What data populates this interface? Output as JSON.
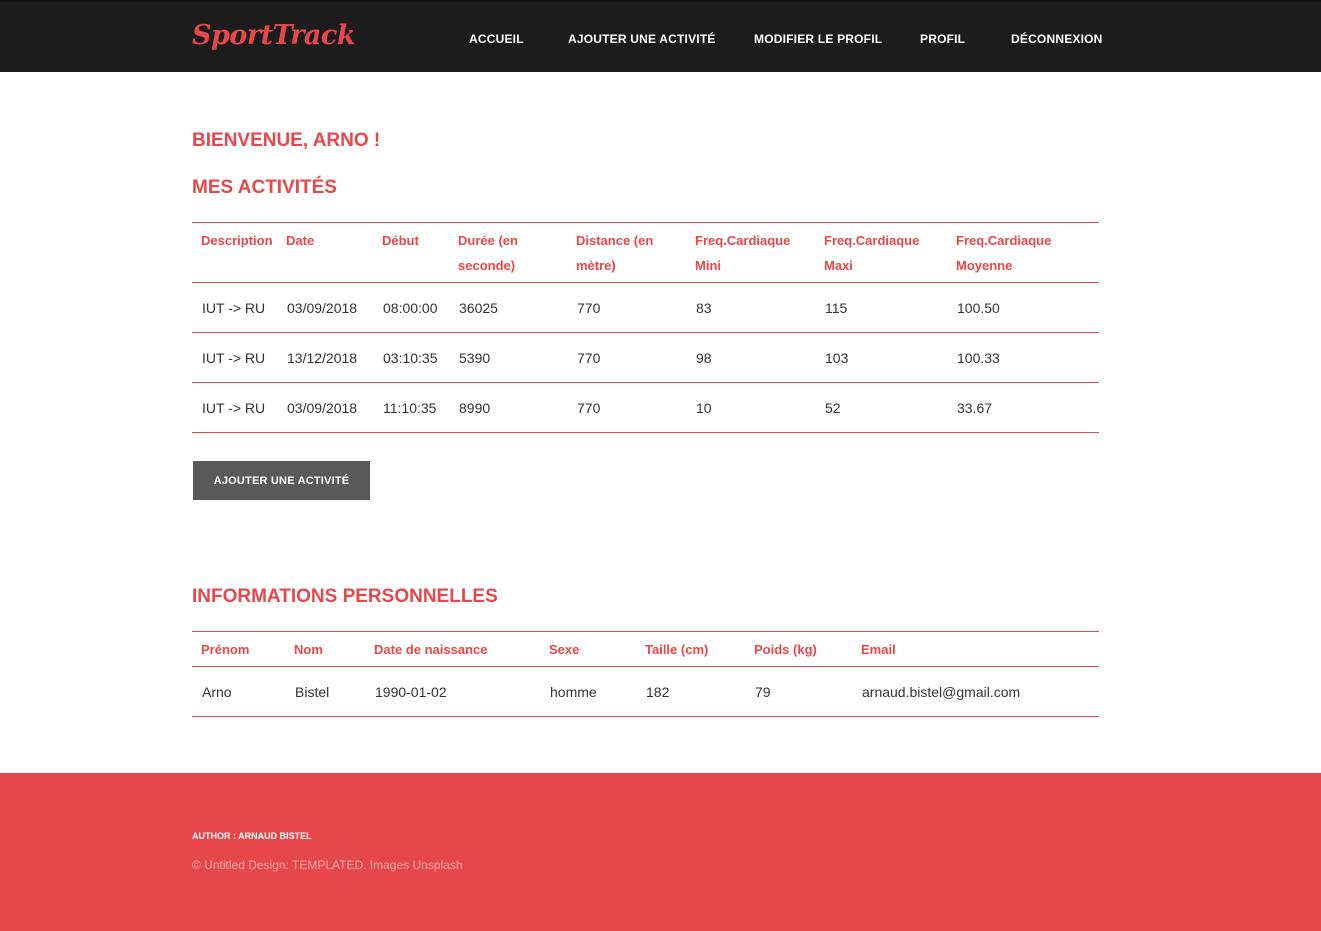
{
  "header": {
    "logo": "SportTrack",
    "nav": [
      {
        "label": "ACCUEIL"
      },
      {
        "label": "AJOUTER UNE ACTIVITÉ"
      },
      {
        "label": "MODIFIER LE PROFIL"
      },
      {
        "label": "PROFIL"
      },
      {
        "label": "DÉCONNEXION"
      }
    ]
  },
  "welcome": "BIENVENUE, ARNO !",
  "activities": {
    "title": "MES ACTIVITÉS",
    "columns": [
      "Description",
      "Date",
      "Début",
      "Durée (en seconde)",
      "Distance (en mètre)",
      "Freq.Cardiaque Mini",
      "Freq.Cardiaque Maxi",
      "Freq.Cardiaque Moyenne"
    ],
    "rows": [
      [
        "IUT -> RU",
        "03/09/2018",
        "08:00:00",
        "36025",
        "770",
        "83",
        "115",
        "100.50"
      ],
      [
        "IUT -> RU",
        "13/12/2018",
        "03:10:35",
        "5390",
        "770",
        "98",
        "103",
        "100.33"
      ],
      [
        "IUT -> RU",
        "03/09/2018",
        "11:10:35",
        "8990",
        "770",
        "10",
        "52",
        "33.67"
      ]
    ],
    "add_button": "AJOUTER UNE ACTIVITÉ"
  },
  "personal": {
    "title": "INFORMATIONS PERSONNELLES",
    "columns": [
      "Prénom",
      "Nom",
      "Date de naissance",
      "Sexe",
      "Taille (cm)",
      "Poids (kg)",
      "Email"
    ],
    "rows": [
      [
        "Arno",
        "Bistel",
        "1990-01-02",
        "homme",
        "182",
        "79",
        "arnaud.bistel@gmail.com"
      ]
    ]
  },
  "footer": {
    "author": "AUTHOR : ARNAUD BISTEL",
    "copyright": "© Untitled Design: TEMPLATED. Images Unsplash"
  },
  "colors": {
    "accent": "#e6474a",
    "header_bg": "#1c1c1c",
    "button_bg": "#595959"
  }
}
